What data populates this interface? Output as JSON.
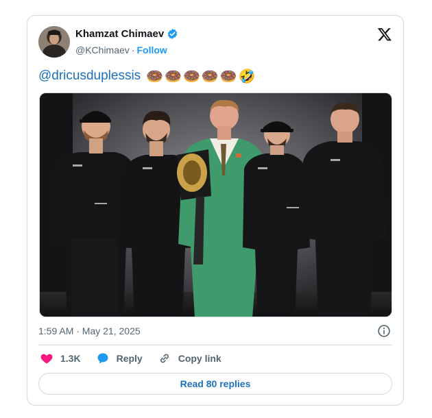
{
  "author": {
    "name": "Khamzat Chimaev",
    "handle": "@KChimaev",
    "separator": "·",
    "follow_label": "Follow"
  },
  "tweet": {
    "mention": "@dricusduplessis",
    "emojis": [
      "🍩",
      "🍩",
      "🍩",
      "🍩",
      "🍩",
      "🤣"
    ],
    "image_alt": "Photo of a man in a green suit holding a championship belt, flanked by four men in black UFC team jackets"
  },
  "timestamp": "1:59 AM · May 21, 2025",
  "actions": {
    "likes": "1.3K",
    "reply_label": "Reply",
    "copy_link_label": "Copy link"
  },
  "read_replies_label": "Read 80 replies",
  "colors": {
    "accent": "#1d9bf0",
    "like": "#f91880",
    "muted": "#536471",
    "border": "#cfd9de",
    "suit_green": "#3f9a6c"
  }
}
